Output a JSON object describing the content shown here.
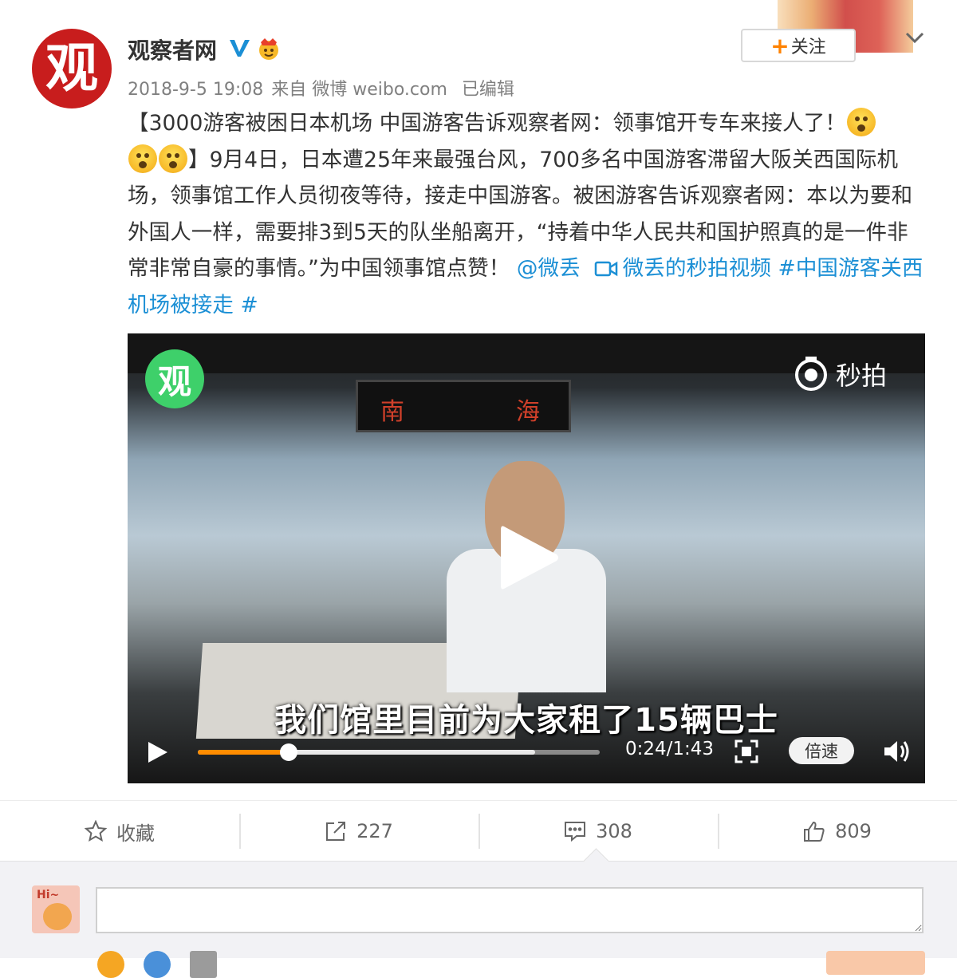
{
  "header": {
    "avatar_char": "观",
    "name": "观察者网",
    "date": "2018-9-5 19:08",
    "source": "来自 微博 weibo.com",
    "edited": "已编辑",
    "follow_label": "关注",
    "follow_plus": "+"
  },
  "post": {
    "p1": "【3000游客被困日本机场 中国游客告诉观察者网：领事馆开专车来接人了！",
    "p2": "】9月4日，日本遭25年来最强台风，700多名中国游客滞留大阪关西国际机场，领事馆工作人员彻夜等待，接走中国游客。被困游客告诉观察者网：本以为要和外国人一样，需要排3到5天的队坐船离开，“持着中华人民共和国护照真的是一件非常非常自豪的事情。”为中国领事馆点赞！ ",
    "mention": "@微丢",
    "video_link": "微丢的秒拍视频",
    "hashtag": "#中国游客关西机场被接走 #"
  },
  "video": {
    "logo_char": "观",
    "brand": "秒拍",
    "sign_left": "南",
    "sign_right": "海",
    "subtitle": "我们馆里目前为大家租了15辆巴士",
    "time": "0:24/1:43",
    "speed_label": "倍速",
    "progress": {
      "played": 0.226,
      "buffered": 0.84
    }
  },
  "actions": {
    "favorite": "收藏",
    "repost": "227",
    "comment": "308",
    "like": "809"
  },
  "comment": {
    "value": ""
  },
  "colors": {
    "accent": "#ff8200",
    "link": "#1b8fd5",
    "avatar_red": "#c81d1d"
  }
}
